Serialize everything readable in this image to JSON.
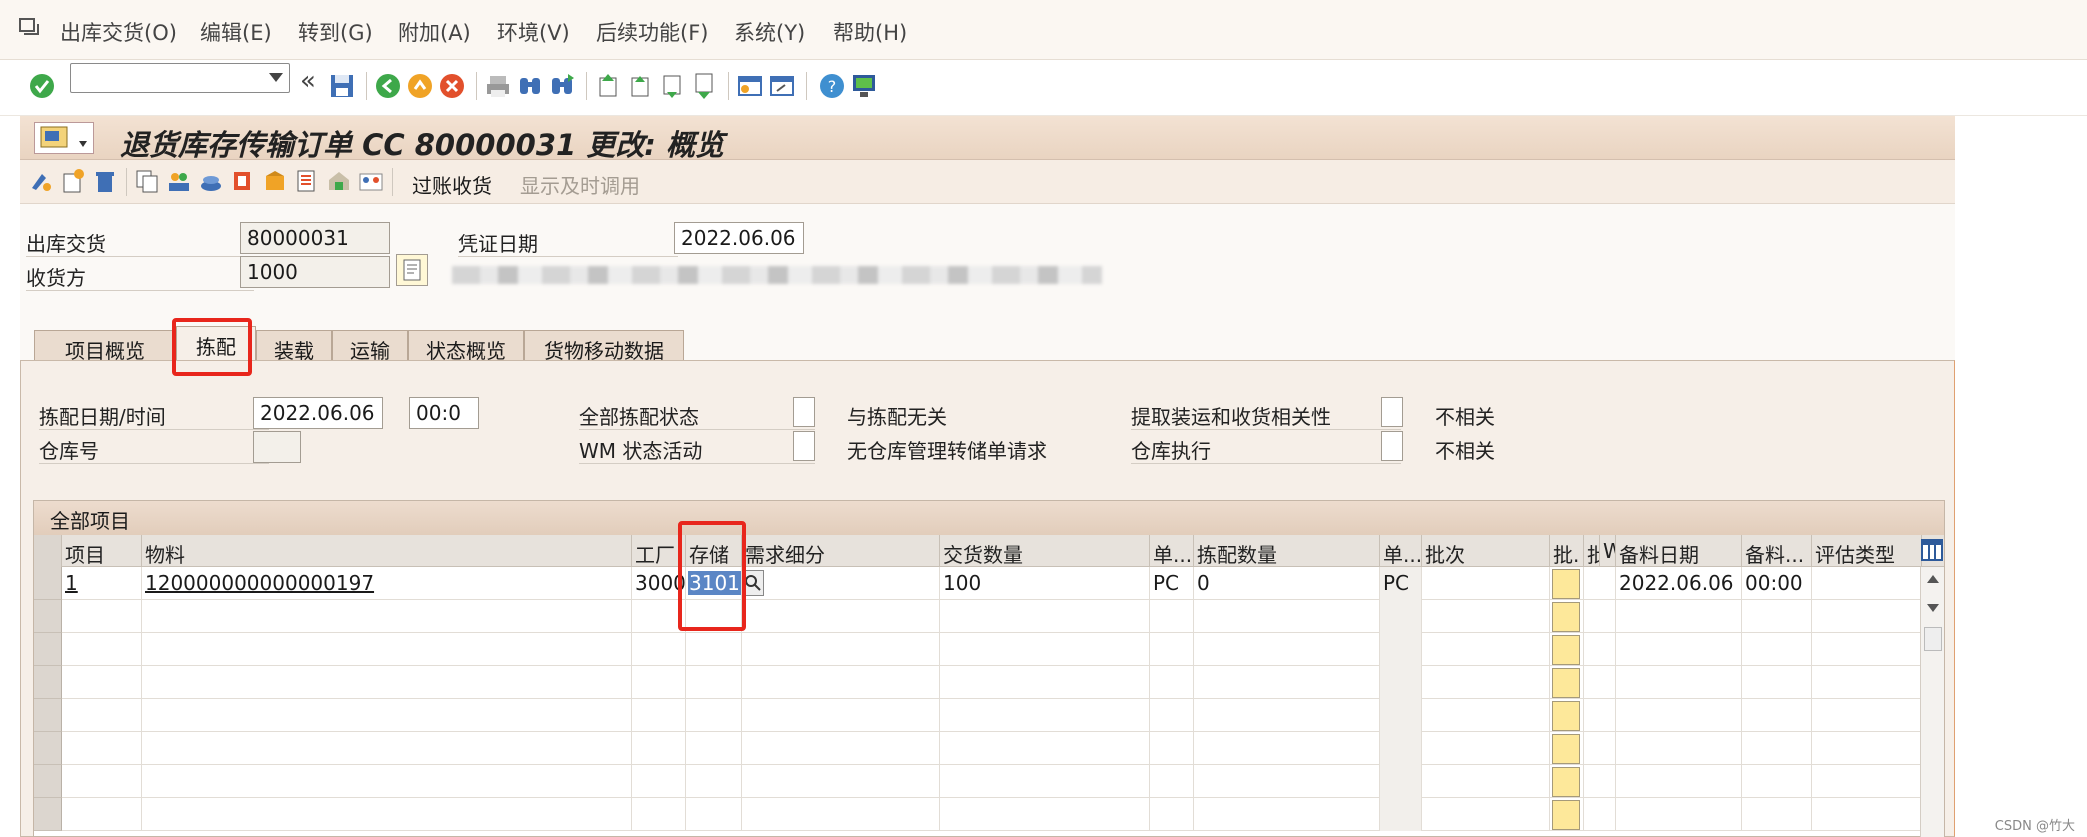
{
  "menu": {
    "items": [
      "出库交货(O)",
      "编辑(E)",
      "转到(G)",
      "附加(A)",
      "环境(V)",
      "后续功能(F)",
      "系统(Y)",
      "帮助(H)"
    ]
  },
  "toolbar": {
    "command_value": "",
    "collapse_glyph": "«"
  },
  "title": {
    "text": "退货库存传输订单 CC 80000031 更改: 概览"
  },
  "app_toolbar": {
    "post_gr_label": "过账收货",
    "show_timing_label": "显示及时调用"
  },
  "header": {
    "outbound_delivery_label": "出库交货",
    "outbound_delivery_value": "80000031",
    "recipient_label": "收货方",
    "recipient_value": "1000",
    "doc_date_label": "凭证日期",
    "doc_date_value": "2022.06.06"
  },
  "tabs": [
    {
      "label": "项目概览"
    },
    {
      "label": "拣配"
    },
    {
      "label": "装载"
    },
    {
      "label": "运输"
    },
    {
      "label": "状态概览"
    },
    {
      "label": "货物移动数据"
    }
  ],
  "picking": {
    "pick_datetime_label": "拣配日期/时间",
    "pick_date": "2022.06.06",
    "pick_time": "00:0",
    "warehouse_no_label": "仓库号",
    "overall_pick_status_label": "全部拣配状态",
    "pick_irrelevant_text": "与拣配无关",
    "wm_status_label": "WM 状态活动",
    "no_wm_text": "无仓库管理转储单请求",
    "relevance_label": "提取装运和收货相关性",
    "relevance_value": "不相关",
    "wh_exec_label": "仓库执行",
    "wh_exec_value": "不相关"
  },
  "table": {
    "title": "全部项目",
    "columns": [
      "项目",
      "物料",
      "工厂",
      "存储",
      "需求细分",
      "交货数量",
      "单...",
      "拣配数量",
      "单...",
      "批次",
      "批.",
      "批",
      "W",
      "备料日期",
      "备料...",
      "评估类型"
    ],
    "row1": {
      "item": "1",
      "material": "120000000000000197",
      "plant": "3000",
      "storage": "3101",
      "qty": "100",
      "unit": "PC",
      "pick_qty": "0",
      "unit2": "PC",
      "stage_date": "2022.06.06",
      "stage_time": "00:00"
    }
  },
  "watermark": "CSDN @竹大"
}
